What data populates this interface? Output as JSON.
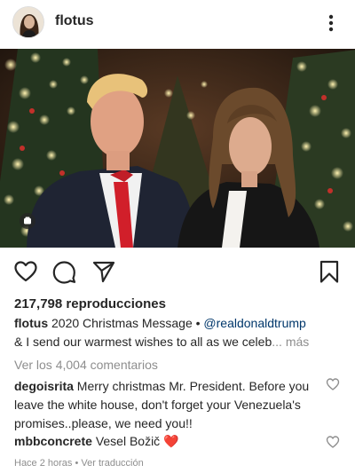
{
  "post": {
    "username": "flotus",
    "views": "217,798 reproducciones",
    "caption": {
      "username": "flotus",
      "text_line1": "2020 Christmas Message • ",
      "mention": "@realdonaldtrump",
      "text_line2": "& I send our warmest wishes to all as we celeb",
      "ellipsis": "...",
      "more": "más"
    },
    "view_all_comments": "Ver los 4,004 comentarios",
    "comments": [
      {
        "username": "degoisrita",
        "text": "Merry christmas Mr. President. Before you leave the white house, don't forget your Venezuela's promises..please, we need you!!"
      },
      {
        "username": "mbbconcrete",
        "text": "Vesel Božič ",
        "emoji": "❤️"
      }
    ],
    "time": "Hace 2 horas",
    "separator": "•",
    "translate": "Ver traducción"
  },
  "icons": {
    "menu": "more-vertical-icon",
    "like": "heart-outline-icon",
    "comment": "comment-bubble-icon",
    "share": "send-paper-plane-icon",
    "save": "bookmark-outline-icon",
    "video": "video-indicator-icon",
    "comment_like": "heart-small-outline-icon"
  },
  "colors": {
    "text": "#262626",
    "secondary": "#8e8e8e",
    "mention": "#00376b",
    "heart": "#e0245e"
  }
}
